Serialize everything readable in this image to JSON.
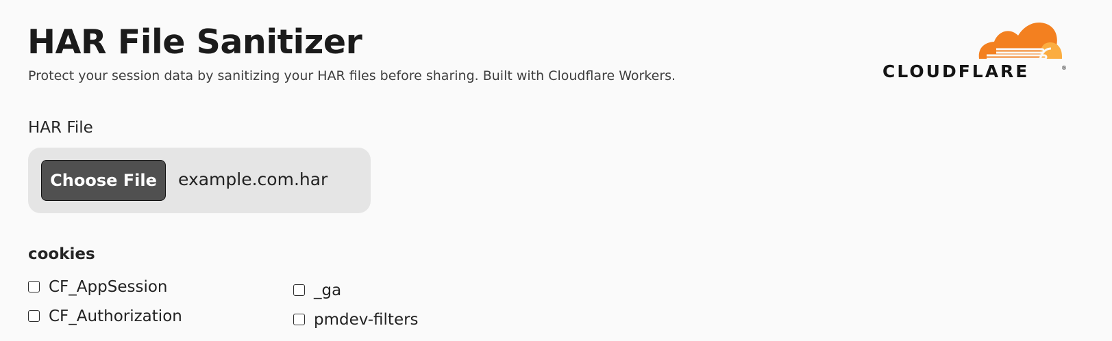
{
  "page": {
    "title": "HAR File Sanitizer",
    "subtitle": "Protect your session data by sanitizing your HAR files before sharing. Built with Cloudflare Workers."
  },
  "brand": {
    "logo_text": "CLOUDFLARE",
    "registered_mark": "®",
    "cloud_icon": "cloudflare-cloud-icon",
    "colors": {
      "primary_orange": "#F38020",
      "secondary_orange": "#FBAD41",
      "dark_text": "#141414"
    }
  },
  "upload": {
    "label": "HAR File",
    "button_label": "Choose File",
    "selected_file": "example.com.har"
  },
  "cookies": {
    "title": "cookies",
    "left_items": [
      {
        "label": "CF_AppSession",
        "checked": false
      },
      {
        "label": "CF_Authorization",
        "checked": false
      }
    ],
    "right_items": [
      {
        "label": "_ga",
        "checked": false
      },
      {
        "label": "pmdev-filters",
        "checked": false
      }
    ]
  }
}
